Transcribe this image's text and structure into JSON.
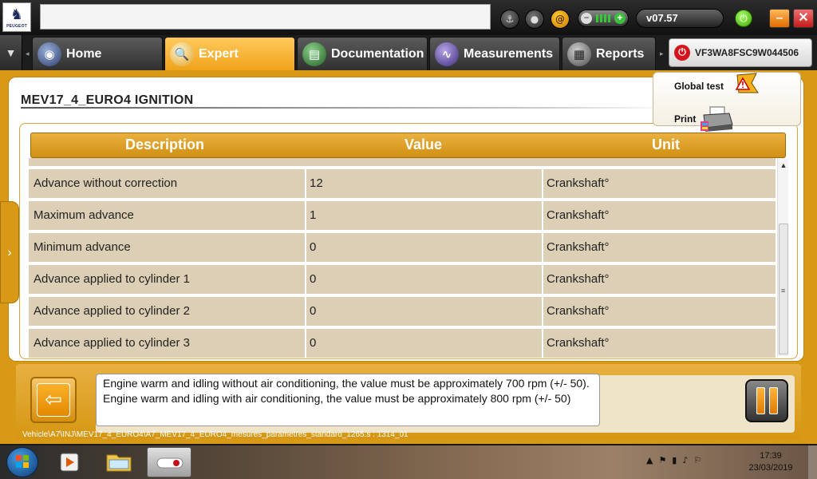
{
  "app": {
    "brand": "PEUGEOT",
    "version": "v07.57",
    "vin": "VF3WA8FSC9W044506"
  },
  "tabs": [
    {
      "label": "Home",
      "icon": "home-icon"
    },
    {
      "label": "Expert",
      "icon": "magnifier-icon",
      "active": true
    },
    {
      "label": "Documentation",
      "icon": "book-icon"
    },
    {
      "label": "Measurements",
      "icon": "waveform-icon"
    },
    {
      "label": "Reports",
      "icon": "report-icon"
    }
  ],
  "page": {
    "title": "MEV17_4_EURO4  IGNITION"
  },
  "actions": {
    "global_test": "Global test",
    "print": "Print"
  },
  "table": {
    "headers": [
      "Description",
      "Value",
      "Unit"
    ],
    "rows": [
      {
        "description": "Advance without correction",
        "value": "12",
        "unit": "Crankshaft°"
      },
      {
        "description": "Maximum advance",
        "value": "1",
        "unit": "Crankshaft°"
      },
      {
        "description": "Minimum advance",
        "value": "0",
        "unit": "Crankshaft°"
      },
      {
        "description": "Advance applied to cylinder 1",
        "value": "0",
        "unit": "Crankshaft°"
      },
      {
        "description": "Advance applied to cylinder 2",
        "value": "0",
        "unit": "Crankshaft°"
      },
      {
        "description": "Advance applied to cylinder 3",
        "value": "0",
        "unit": "Crankshaft°"
      }
    ]
  },
  "help_text": "Engine warm and idling without air conditioning, the value must be approximately 700 rpm (+/- 50). Engine warm and idling with air conditioning, the value must be approximately 800 rpm (+/- 50)",
  "path": "Vehicle\\A7\\INJ\\MEV17_4_EURO4\\A7_MEV17_4_EURO4_mesures_parametres_standard_1265.s : 1314_01",
  "taskbar": {
    "time": "17:39",
    "date": "23/03/2019"
  },
  "colors": {
    "accent": "#d89a16",
    "row": "#ddcfb5",
    "header": "#eab140"
  }
}
